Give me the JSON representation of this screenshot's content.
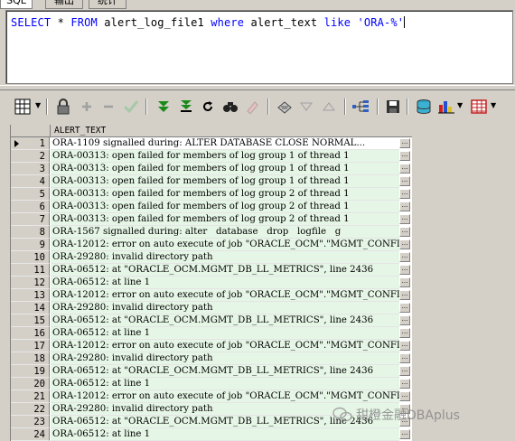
{
  "tabs": [
    {
      "label": "SQL",
      "active": true
    },
    {
      "label": "输出",
      "active": false
    },
    {
      "label": "统计",
      "active": false
    }
  ],
  "editor": {
    "kw_select": "SELECT",
    "star": " * ",
    "kw_from": "FROM",
    "table": " alert_log_file1 ",
    "kw_where": "where",
    "column": " alert_text ",
    "kw_like": "like",
    "literal": " 'ORA-%'"
  },
  "toolbar": {
    "icons": [
      "grid-icon",
      "lock-icon",
      "add-icon",
      "delete-icon",
      "check-icon",
      "next-icon",
      "last-icon",
      "refresh-icon",
      "find-icon",
      "clear-icon",
      "export-icon",
      "down-icon",
      "up-icon",
      "tree-icon",
      "save-icon",
      "database-icon",
      "chart-icon",
      "table-icon"
    ]
  },
  "grid": {
    "column_header": "ALERT_TEXT",
    "rows": [
      {
        "num": "1",
        "text": "ORA-1109 signalled during: ALTER DATABASE CLOSE NORMAL..."
      },
      {
        "num": "2",
        "text": "ORA-00313: open failed for members of log group 1 of thread 1"
      },
      {
        "num": "3",
        "text": "ORA-00313: open failed for members of log group 1 of thread 1"
      },
      {
        "num": "4",
        "text": "ORA-00313: open failed for members of log group 1 of thread 1"
      },
      {
        "num": "5",
        "text": "ORA-00313: open failed for members of log group 2 of thread 1"
      },
      {
        "num": "6",
        "text": "ORA-00313: open failed for members of log group 2 of thread 1"
      },
      {
        "num": "7",
        "text": "ORA-00313: open failed for members of log group 2 of thread 1"
      },
      {
        "num": "8",
        "text": "ORA-1567 signalled during: alter   database   drop   logfile   g"
      },
      {
        "num": "9",
        "text": "ORA-12012: error on auto execute of job \"ORACLE_OCM\".\"MGMT_CONFI"
      },
      {
        "num": "10",
        "text": "ORA-29280: invalid directory path"
      },
      {
        "num": "11",
        "text": "ORA-06512: at \"ORACLE_OCM.MGMT_DB_LL_METRICS\", line 2436"
      },
      {
        "num": "12",
        "text": "ORA-06512: at line 1"
      },
      {
        "num": "13",
        "text": "ORA-12012: error on auto execute of job \"ORACLE_OCM\".\"MGMT_CONFI"
      },
      {
        "num": "14",
        "text": "ORA-29280: invalid directory path"
      },
      {
        "num": "15",
        "text": "ORA-06512: at \"ORACLE_OCM.MGMT_DB_LL_METRICS\", line 2436"
      },
      {
        "num": "16",
        "text": "ORA-06512: at line 1"
      },
      {
        "num": "17",
        "text": "ORA-12012: error on auto execute of job \"ORACLE_OCM\".\"MGMT_CONFI"
      },
      {
        "num": "18",
        "text": "ORA-29280: invalid directory path"
      },
      {
        "num": "19",
        "text": "ORA-06512: at \"ORACLE_OCM.MGMT_DB_LL_METRICS\", line 2436"
      },
      {
        "num": "20",
        "text": "ORA-06512: at line 1"
      },
      {
        "num": "21",
        "text": "ORA-12012: error on auto execute of job \"ORACLE_OCM\".\"MGMT_CONFI"
      },
      {
        "num": "22",
        "text": "ORA-29280: invalid directory path"
      },
      {
        "num": "23",
        "text": "ORA-06512: at \"ORACLE_OCM.MGMT_DB_LL_METRICS\", line 2436"
      },
      {
        "num": "24",
        "text": "ORA-06512: at line 1"
      }
    ],
    "cell_button": "..."
  },
  "watermark": {
    "text": "甜橙金融DBAplus"
  }
}
